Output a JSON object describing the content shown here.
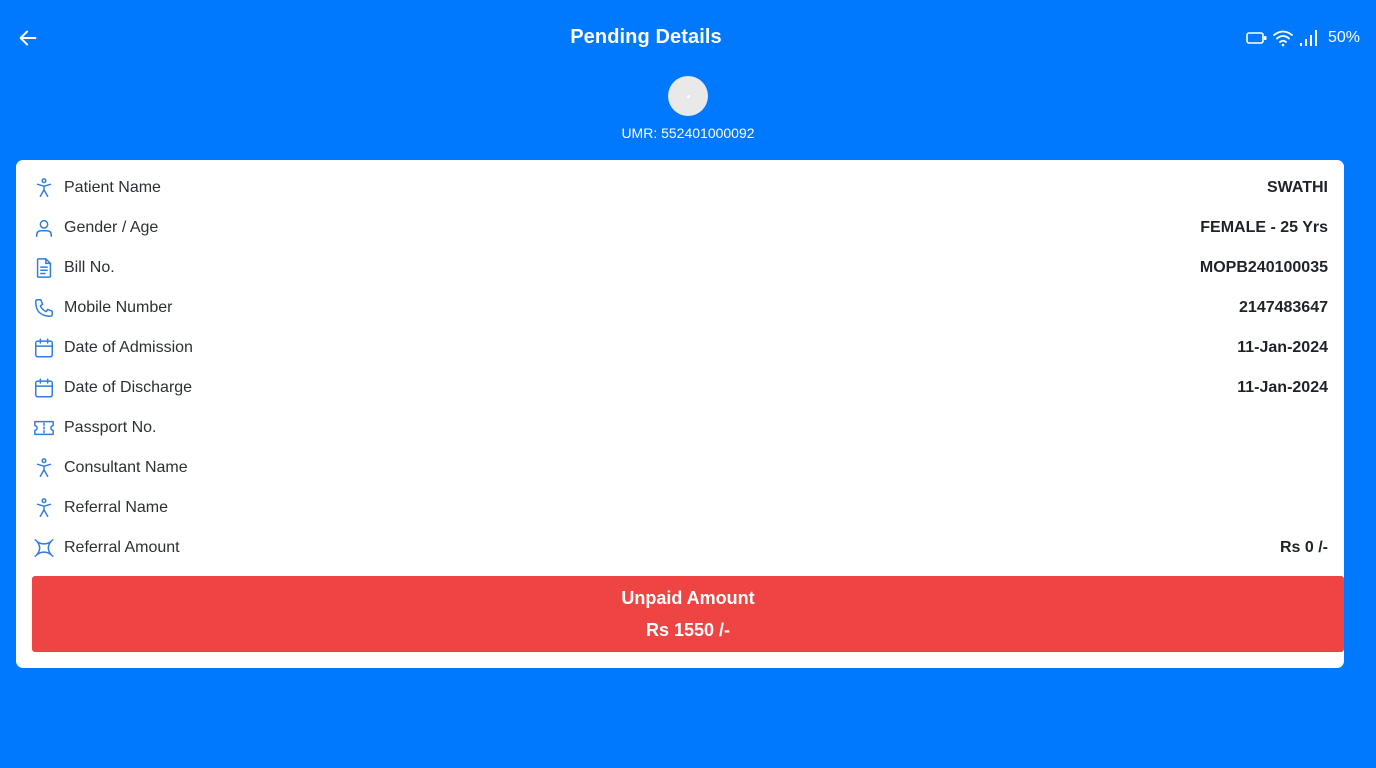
{
  "header": {
    "title": "Pending Details",
    "back_icon": "arrow-left-icon",
    "status": {
      "battery": "50%"
    }
  },
  "patient": {
    "umr": "UMR: 552401000092"
  },
  "details": [
    {
      "label": "Patient Name",
      "value": "SWATHI",
      "icon": "person-icon"
    },
    {
      "label": "Gender / Age",
      "value": "FEMALE - 25 Yrs",
      "icon": "user-icon"
    },
    {
      "label": "Bill No.",
      "value": "MOPB240100035",
      "icon": "document-icon"
    },
    {
      "label": "Mobile Number",
      "value": "2147483647",
      "icon": "phone-icon"
    },
    {
      "label": "Date of Admission",
      "value": "11-Jan-2024",
      "icon": "calendar-icon"
    },
    {
      "label": "Date of Discharge",
      "value": "11-Jan-2024",
      "icon": "calendar-icon"
    },
    {
      "label": "Passport No.",
      "value": "",
      "icon": "ticket-icon"
    },
    {
      "label": "Consultant Name",
      "value": "",
      "icon": "person-icon"
    },
    {
      "label": "Referral Name",
      "value": "",
      "icon": "person-icon"
    },
    {
      "label": "Referral Amount",
      "value": "Rs 0 /-",
      "icon": "currency-icon"
    }
  ],
  "unpaid": {
    "label": "Unpaid Amount",
    "amount": "Rs 1550 /-"
  },
  "colors": {
    "background": "#0179fe",
    "accent_icon": "#2f7de1",
    "unpaid": "#ef4444"
  }
}
